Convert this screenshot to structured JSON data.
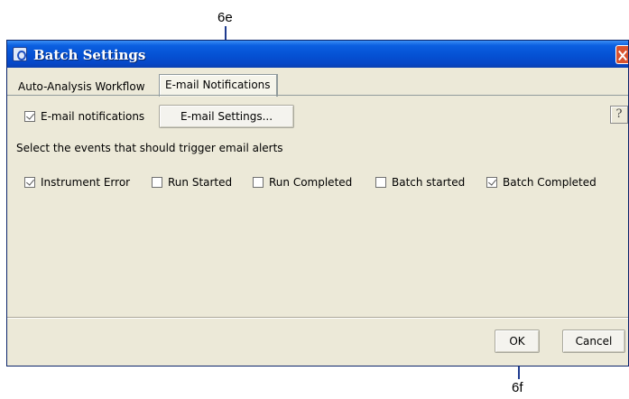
{
  "callouts": {
    "top_label": "6e",
    "bottom_label": "6f"
  },
  "window": {
    "title": "Batch Settings"
  },
  "tabs": [
    {
      "label": "Auto-Analysis Workflow",
      "active": false
    },
    {
      "label": "E-mail Notifications",
      "active": true
    }
  ],
  "email": {
    "enable_label": "E-mail notifications",
    "enable_checked": true,
    "settings_button": "E-mail Settings...",
    "help_button": "?",
    "events_prompt": "Select the events that should trigger email alerts",
    "events": [
      {
        "label": "Instrument Error",
        "checked": true
      },
      {
        "label": "Run Started",
        "checked": false
      },
      {
        "label": "Run Completed",
        "checked": false
      },
      {
        "label": "Batch started",
        "checked": false
      },
      {
        "label": "Batch Completed",
        "checked": true
      }
    ]
  },
  "footer": {
    "ok_label": "OK",
    "cancel_label": "Cancel"
  },
  "colors": {
    "titlebar": "#0551d3",
    "dialog_bg": "#ece9d8",
    "close_button": "#d9532f",
    "callout_line": "#1f3b8f"
  },
  "icons": {
    "title_icon": "app-icon",
    "close_icon": "close-icon"
  }
}
